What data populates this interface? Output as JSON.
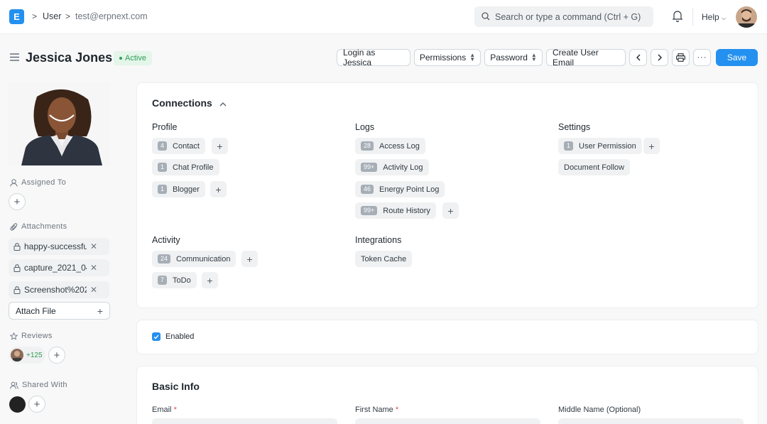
{
  "navbar": {
    "logo_letter": "E",
    "breadcrumbs": [
      "User",
      "test@erpnext.com"
    ],
    "search_placeholder": "Search or type a command (Ctrl + G)",
    "help_label": "Help"
  },
  "page": {
    "title": "Jessica Jones",
    "status": "Active",
    "status_color": "#2f9d58",
    "actions": {
      "login_as": "Login as Jessica",
      "permissions": "Permissions",
      "password": "Password",
      "create_email": "Create User Email",
      "save": "Save"
    }
  },
  "sidebar": {
    "assigned_to": "Assigned To",
    "attachments_label": "Attachments",
    "attachments": [
      "happy-successfu",
      "capture_2021_04",
      "Screenshot%202"
    ],
    "attach_file": "Attach File",
    "reviews_label": "Reviews",
    "reviews_count": "+125",
    "shared_with": "Shared With"
  },
  "connections": {
    "title": "Connections",
    "groups": {
      "profile": {
        "heading": "Profile",
        "items": [
          {
            "count": "4",
            "label": "Contact"
          },
          {
            "count": "1",
            "label": "Chat Profile"
          },
          {
            "count": "1",
            "label": "Blogger"
          }
        ]
      },
      "logs": {
        "heading": "Logs",
        "items": [
          {
            "count": "28",
            "label": "Access Log"
          },
          {
            "count": "99+",
            "label": "Activity Log"
          },
          {
            "count": "46",
            "label": "Energy Point Log"
          },
          {
            "count": "99+",
            "label": "Route History"
          }
        ]
      },
      "settings": {
        "heading": "Settings",
        "items": [
          {
            "count": "1",
            "label": "User Permission"
          },
          {
            "count": "",
            "label": "Document Follow"
          }
        ]
      },
      "activity": {
        "heading": "Activity",
        "items": [
          {
            "count": "24",
            "label": "Communication"
          },
          {
            "count": "7",
            "label": "ToDo"
          }
        ]
      },
      "integrations": {
        "heading": "Integrations",
        "items": [
          {
            "count": "",
            "label": "Token Cache"
          }
        ]
      }
    }
  },
  "enabled": {
    "label": "Enabled",
    "checked": true
  },
  "basic_info": {
    "title": "Basic Info",
    "fields": {
      "email": "Email",
      "first_name": "First Name",
      "middle_name": "Middle Name (Optional)"
    },
    "required_mark": "*"
  },
  "colors": {
    "accent": "#2490ef"
  },
  "icons": [
    "search-icon",
    "bell-icon",
    "menu-icon",
    "print-icon",
    "more-icon",
    "chevron-left-icon",
    "chevron-right-icon",
    "user-icon",
    "paperclip-icon",
    "star-icon",
    "users-icon",
    "lock-icon",
    "close-icon",
    "plus-icon",
    "chevron-up-icon",
    "check-icon"
  ]
}
